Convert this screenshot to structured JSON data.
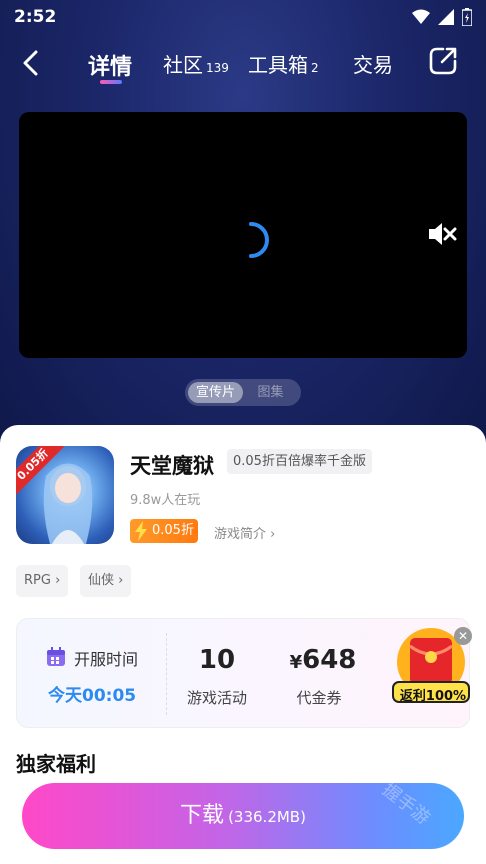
{
  "status_bar": {
    "time": "2:52"
  },
  "nav": {
    "tabs": [
      {
        "label": "详情",
        "badge": ""
      },
      {
        "label": "社区",
        "badge": "139"
      },
      {
        "label": "工具箱",
        "badge": "2"
      },
      {
        "label": "交易",
        "badge": ""
      }
    ]
  },
  "media_toggle": {
    "options": [
      "宣传片",
      "图集"
    ],
    "selected": "宣传片"
  },
  "game": {
    "icon_ribbon": "0.05折",
    "name": "天堂魔狱",
    "version_tag": "0.05折百倍爆率千金版",
    "players": "9.8w人在玩",
    "discount": "0.05折",
    "intro_link": "游戏简介"
  },
  "tags": [
    "RPG",
    "仙侠"
  ],
  "info_card": {
    "open_label": "开服时间",
    "open_time": "今天00:05",
    "activities_count": "10",
    "activities_label": "游戏活动",
    "voucher_currency": "¥",
    "voucher_amount": "648",
    "voucher_label": "代金券",
    "rebate_text": "返利100%"
  },
  "section": {
    "title": "独家福利"
  },
  "download": {
    "label": "下载",
    "size": "(336.2MB)"
  },
  "watermark": "握手游",
  "colors": {
    "accent_blue": "#2d8af0",
    "discount_orange": "#ff7a10",
    "download_gradient_start": "#ff48c8",
    "download_gradient_end": "#4aa8ff"
  }
}
